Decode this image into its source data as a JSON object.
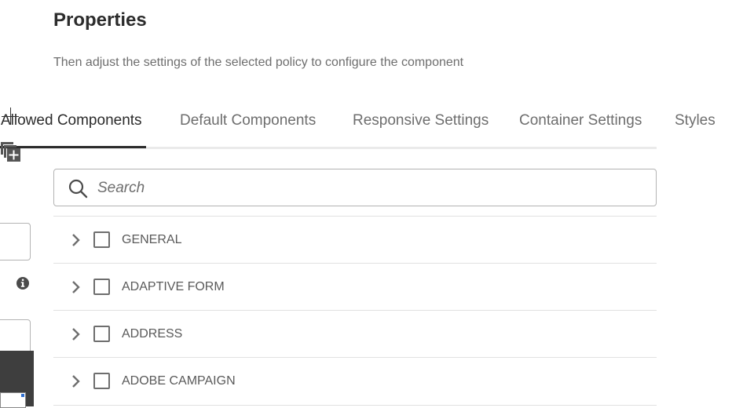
{
  "header": {
    "title": "Properties",
    "subtitle": "Then adjust the settings of the selected policy to configure the component"
  },
  "tabs": [
    {
      "label": "Allowed Components",
      "active": true
    },
    {
      "label": "Default Components",
      "active": false
    },
    {
      "label": "Responsive Settings",
      "active": false
    },
    {
      "label": "Container Settings",
      "active": false
    },
    {
      "label": "Styles",
      "active": false
    }
  ],
  "search": {
    "placeholder": "Search",
    "value": ""
  },
  "component_groups": [
    {
      "label": "GENERAL",
      "checked": false,
      "expanded": false
    },
    {
      "label": "ADAPTIVE FORM",
      "checked": false,
      "expanded": false
    },
    {
      "label": "ADDRESS",
      "checked": false,
      "expanded": false
    },
    {
      "label": "ADOBE CAMPAIGN",
      "checked": false,
      "expanded": false
    }
  ],
  "icons": {
    "search": "search-icon",
    "expand": "chevron-right-icon",
    "info": "info-icon",
    "add_component": "add-component-icon"
  },
  "colors": {
    "text_primary": "#2c2c2c",
    "text_secondary": "#6e6e6e",
    "border": "#b3b3b3",
    "divider": "#e1e1e1"
  }
}
